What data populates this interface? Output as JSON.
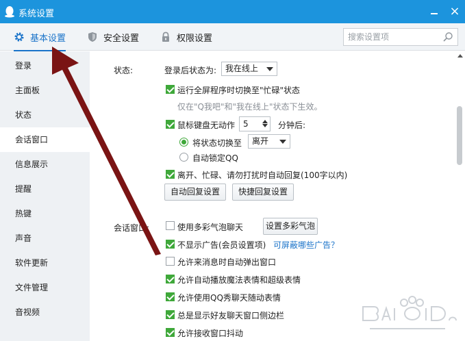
{
  "window": {
    "title": "系统设置",
    "close_symbol": "×"
  },
  "tabs": [
    {
      "label": "基本设置",
      "icon": "gear-icon"
    },
    {
      "label": "安全设置",
      "icon": "shield-icon"
    },
    {
      "label": "权限设置",
      "icon": "lock-icon"
    }
  ],
  "search": {
    "placeholder": "搜索设置项"
  },
  "sidebar": {
    "items": [
      {
        "label": "登录"
      },
      {
        "label": "主面板"
      },
      {
        "label": "状态"
      },
      {
        "label": "会话窗口"
      },
      {
        "label": "信息展示"
      },
      {
        "label": "提醒"
      },
      {
        "label": "热键"
      },
      {
        "label": "声音"
      },
      {
        "label": "软件更新"
      },
      {
        "label": "文件管理"
      },
      {
        "label": "音视频"
      }
    ]
  },
  "status_section": {
    "label": "状态:",
    "login_status_label": "登录后状态为:",
    "login_status_value": "我在线上",
    "fullscreen_busy": {
      "label": "运行全屏程序时切换至\"忙碌\"状态",
      "checked": true
    },
    "fullscreen_hint": "仅在\"Q我吧\"和\"我在线上\"状态下生效。",
    "idle": {
      "label": "鼠标键盘无动作",
      "checked": true,
      "minutes": "5",
      "suffix": "分钟后:"
    },
    "switch_status": {
      "label": "将状态切换至",
      "selected": true,
      "value": "离开"
    },
    "auto_lock": {
      "label": "自动锁定QQ",
      "selected": false
    },
    "auto_reply": {
      "label": "离开、忙碌、请勿打扰时自动回复(100字以内)",
      "checked": true
    },
    "btn_auto_reply": "自动回复设置",
    "btn_quick_reply": "快捷回复设置"
  },
  "session_section": {
    "label": "会话窗口:",
    "colorful_bubble": {
      "label": "使用多彩气泡聊天",
      "checked": false
    },
    "btn_bubble": "设置多彩气泡",
    "no_ads": {
      "label": "不显示广告(会员设置项)",
      "checked": true
    },
    "ads_link": "可屏蔽哪些广告？",
    "popup": {
      "label": "允许来消息时自动弹出窗口",
      "checked": false
    },
    "magic_expr": {
      "label": "允许自动播放魔法表情和超级表情",
      "checked": true
    },
    "qq_show": {
      "label": "允许使用QQ秀聊天随动表情",
      "checked": true
    },
    "sidebar_show": {
      "label": "总是显示好友聊天窗口侧边栏",
      "checked": true
    },
    "shake": {
      "label": "允许接收窗口抖动",
      "checked": true
    }
  },
  "colors": {
    "titlebar": "#1c94dd",
    "accent": "#1a73c9",
    "check": "#3fa83a",
    "arrow": "#7a1414"
  }
}
